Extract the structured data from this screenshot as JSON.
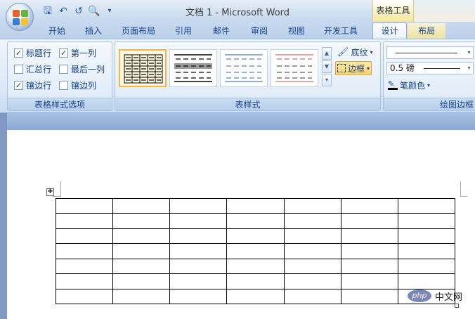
{
  "window": {
    "title": "文档 1 - Microsoft Word",
    "contextual_group": "表格工具"
  },
  "quick_access": [
    "save-icon",
    "undo-icon",
    "redo-icon",
    "print-preview-icon",
    "customize-icon"
  ],
  "tabs": [
    {
      "label": "开始"
    },
    {
      "label": "插入"
    },
    {
      "label": "页面布局"
    },
    {
      "label": "引用"
    },
    {
      "label": "邮件"
    },
    {
      "label": "审阅"
    },
    {
      "label": "视图"
    },
    {
      "label": "开发工具"
    },
    {
      "label": "设计",
      "active": true
    },
    {
      "label": "布局"
    }
  ],
  "ribbon": {
    "style_options": {
      "label": "表格样式选项",
      "options": [
        {
          "label": "标题行",
          "checked": true
        },
        {
          "label": "第一列",
          "checked": true
        },
        {
          "label": "汇总行",
          "checked": false
        },
        {
          "label": "最后一列",
          "checked": false
        },
        {
          "label": "镶边行",
          "checked": true
        },
        {
          "label": "镶边列",
          "checked": false
        }
      ]
    },
    "table_styles": {
      "label": "表样式",
      "shading_label": "底纹",
      "borders_label": "边框"
    },
    "draw_borders": {
      "label": "绘图边框",
      "line_weight": "0.5 磅",
      "pen_color_label": "笔颜色"
    }
  },
  "document": {
    "table_rows": 7,
    "table_cols": 7
  },
  "watermark": {
    "logo_text": "php",
    "site_text": "中文网"
  },
  "colors": {
    "accent": "#15428b",
    "active_tab_highlight": "#f4e79b",
    "selected_swatch_border": "#f1b74c"
  }
}
